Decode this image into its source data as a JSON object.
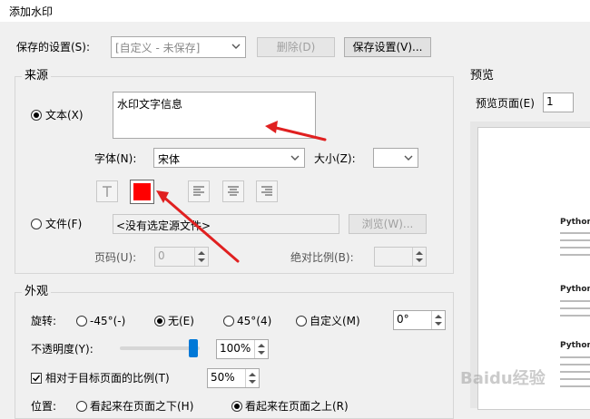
{
  "window": {
    "title": "添加水印"
  },
  "settings": {
    "label": "保存的设置(S):",
    "value": "[自定义 - 未保存]",
    "delete_label": "删除(D)",
    "save_label": "保存设置(V)..."
  },
  "source": {
    "legend": "来源",
    "text_radio": "文本(X)",
    "text_value": "水印文字信息",
    "font_label": "字体(N):",
    "font_value": "宋体",
    "size_label": "大小(Z):",
    "size_value": "",
    "color_value": "#ff0000",
    "file_radio": "文件(F)",
    "file_value": "<没有选定源文件>",
    "browse_label": "浏览(W)...",
    "page_label": "页码(U):",
    "page_value": "0",
    "scale_label": "绝对比例(B):",
    "scale_value": ""
  },
  "appearance": {
    "legend": "外观",
    "rotate_label": "旋转:",
    "rotate_options": [
      "-45°(-)",
      "无(E)",
      "45°(4)",
      "自定义(M)"
    ],
    "rotate_selected": "无(E)",
    "rotate_custom_value": "0°",
    "opacity_label": "不透明度(Y):",
    "opacity_value": "100%",
    "opacity_level": 1.0,
    "relative_label": "相对于目标页面的比例(T)",
    "relative_checked": true,
    "relative_value": "50%",
    "position_label": "位置:",
    "position_options": [
      "看起来在页面之下(H)",
      "看起来在页面之上(R)"
    ],
    "position_selected": "看起来在页面之上(R)"
  },
  "preview": {
    "legend": "预览",
    "page_label": "预览页面(E)",
    "page_value": "1",
    "doc_lines": [
      "Python 是什",
      "Python 优点",
      "Python 应月"
    ],
    "watermark": "Baidu经验"
  },
  "annotation_color": "#e02020"
}
